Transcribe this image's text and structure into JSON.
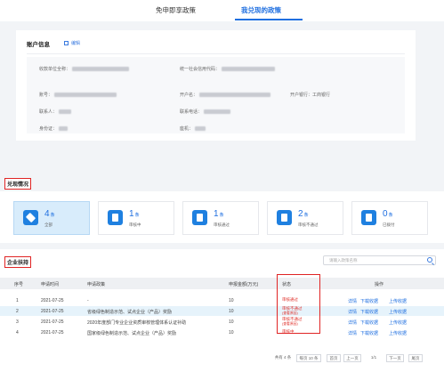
{
  "tabs": [
    {
      "label": "免申即享政策"
    },
    {
      "label": "我兑现的政策"
    }
  ],
  "account": {
    "title": "账户信息",
    "edit_label": "编辑",
    "fields": {
      "payee": "收款单位全称：",
      "credit_code": "统一社会信用代码：",
      "account_no": "账号：",
      "account_name": "开户名：",
      "bank": "开户银行：工商银行",
      "contact": "联系人：",
      "phone": "联系电话：",
      "id_card": "身份证：",
      "landline": "座机："
    }
  },
  "redemption": {
    "section_label": "兑现情况",
    "cards": [
      {
        "count": "4",
        "unit": "条",
        "label": "全部"
      },
      {
        "count": "1",
        "unit": "条",
        "label": "审核中"
      },
      {
        "count": "1",
        "unit": "条",
        "label": "审核通过"
      },
      {
        "count": "2",
        "unit": "条",
        "label": "审核不通过"
      },
      {
        "count": "0",
        "unit": "条",
        "label": "已拨付"
      }
    ]
  },
  "table": {
    "section_label": "企业扶持",
    "search_placeholder": "请输入政策名称",
    "headers": [
      "序号",
      "申请时间",
      "申请政策",
      "申报金额(万元)",
      "状态",
      "操作"
    ],
    "rows": [
      {
        "no": "1",
        "date": "2021-07-25",
        "policy": "-",
        "amount": "10",
        "status": [
          "审核通过"
        ],
        "ops": [
          "详情",
          "下载收据",
          "上传收据"
        ]
      },
      {
        "no": "2",
        "date": "2021-07-25",
        "policy": "省级绿色制造示范、试点企业（产品）奖励",
        "amount": "10",
        "status": [
          "审核不通过",
          "(查看原因)"
        ],
        "ops": [
          "详情",
          "下载收据",
          "上传收据"
        ]
      },
      {
        "no": "3",
        "date": "2021-07-25",
        "policy": "2020年度部门专业企业资质审核管理体系认证补助",
        "amount": "10",
        "status": [
          "审核不通过",
          "(查看原因)"
        ],
        "ops": [
          "详情",
          "下载收据",
          "上传收据"
        ]
      },
      {
        "no": "4",
        "date": "2021-07-25",
        "policy": "国家级绿色制造示范、试点企业（产品）奖励",
        "amount": "10",
        "status": [
          "审核中"
        ],
        "ops": [
          "详情",
          "下载收据",
          "上传收据"
        ]
      }
    ],
    "pager": {
      "total": "共有 4 条",
      "per_page": "每页 10 条",
      "first": "首页",
      "prev": "上一页",
      "page": "1/1",
      "next": "下一页",
      "last": "尾页"
    }
  }
}
